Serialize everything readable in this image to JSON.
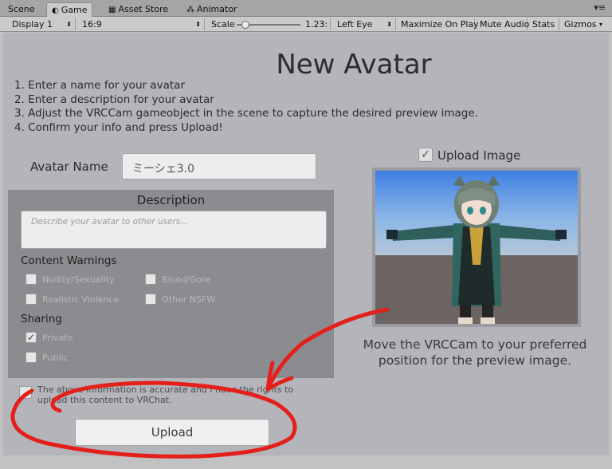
{
  "tabs": [
    {
      "label": "Scene",
      "icon": "scene-icon"
    },
    {
      "label": "Game",
      "icon": "game-icon"
    },
    {
      "label": "Asset Store",
      "icon": "asset-store-icon"
    },
    {
      "label": "Animator",
      "icon": "animator-icon"
    }
  ],
  "toolbar": {
    "display": "Display 1",
    "aspect": "16:9",
    "scale_label": "Scale",
    "scale_value": "1.23:",
    "scale_fraction": 0.08,
    "eye": "Left Eye",
    "maximize": "Maximize On Play",
    "mute": "Mute Audio",
    "stats": "Stats",
    "gizmos": "Gizmos"
  },
  "form": {
    "title": "New Avatar",
    "instructions": [
      "1. Enter a name for your avatar",
      "2. Enter a description for your avatar",
      "3. Adjust the VRCCam gameobject in the scene to capture the desired preview image.",
      "4. Confirm your info and press Upload!"
    ],
    "name_label": "Avatar Name",
    "name_value": "ミーシェ3.0",
    "description_title": "Description",
    "description_placeholder": "Describe your avatar to other users...",
    "content_warnings_label": "Content Warnings",
    "warnings": {
      "nudity": "Nudity/Sexuality",
      "gore": "Blood/Gore",
      "violence": "Realistic Violence",
      "nsfw": "Other NSFW"
    },
    "sharing_label": "Sharing",
    "sharing": {
      "private": "Private",
      "public": "Public"
    },
    "agreement_text": "The above information is accurate and I have the rights to upload this content to VRChat.",
    "upload_label": "Upload",
    "upload_image_label": "Upload Image",
    "move_text": "Move the VRCCam to your preferred position for the preview image."
  },
  "colors": {
    "annotation": "#e3201b",
    "panel": "#8b8c8f",
    "game_bg": "#b3b5bb"
  }
}
